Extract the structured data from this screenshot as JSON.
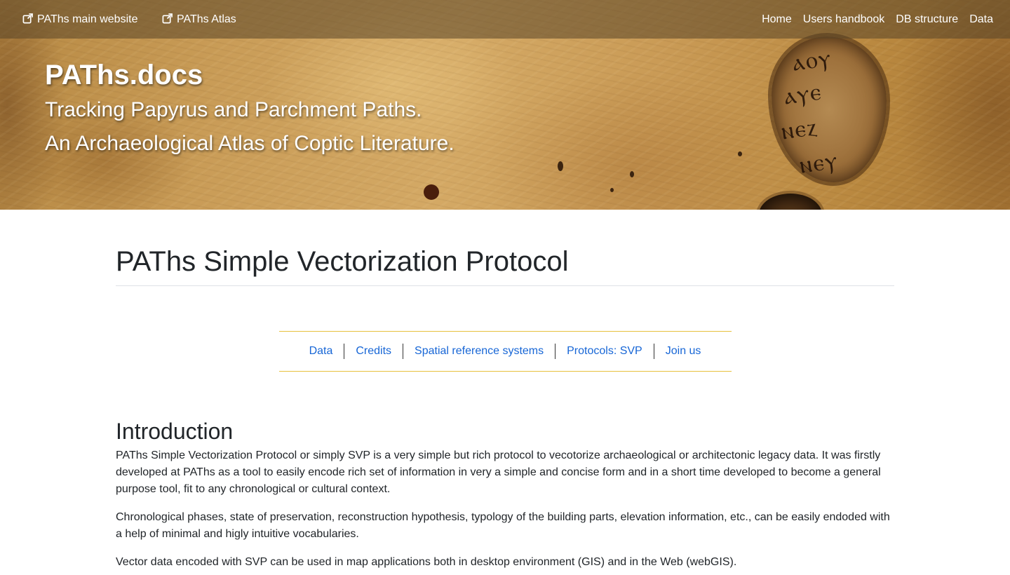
{
  "topbar": {
    "left_links": [
      {
        "label": "PAThs main website",
        "icon": "external-link-icon"
      },
      {
        "label": "PAThs Atlas",
        "icon": "external-link-icon"
      }
    ],
    "right_links": [
      {
        "label": "Home"
      },
      {
        "label": "Users handbook"
      },
      {
        "label": "DB structure"
      },
      {
        "label": "Data"
      }
    ]
  },
  "hero": {
    "title": "PAThs.docs",
    "subtitle_line1": "Tracking Papyrus and Parchment Paths.",
    "subtitle_line2": "An Archaeological Atlas of Coptic Literature."
  },
  "main": {
    "page_title": "PAThs Simple Vectorization Protocol",
    "subnav": [
      {
        "label": "Data"
      },
      {
        "label": "Credits"
      },
      {
        "label": "Spatial reference systems"
      },
      {
        "label": "Protocols: SVP"
      },
      {
        "label": "Join us"
      }
    ],
    "section_title": "Introduction",
    "paragraphs": [
      "PAThs Simple Vectorization Protocol or simply SVP is a very simple but rich protocol to vecotorize archaeological or architectonic legacy data. It was firstly developed at PAThs as a tool to easily encode rich set of information in very a simple and concise form and in a short time developed to become a general purpose tool, fit to any chronological or cultural context.",
      "Chronological phases, state of preservation, reconstruction hypothesis, typology of the building parts, elevation information, etc., can be easily endoded with a help of minimal and higly intuitive vocabularies.",
      "Vector data encoded with SVP can be used in map applications both in desktop environment (GIS) and in the Web (webGIS)."
    ]
  },
  "colors": {
    "link": "#1766d6",
    "subnav_rule": "#e7c13c",
    "text": "#212529",
    "topbar_overlay": "#5a4628"
  }
}
